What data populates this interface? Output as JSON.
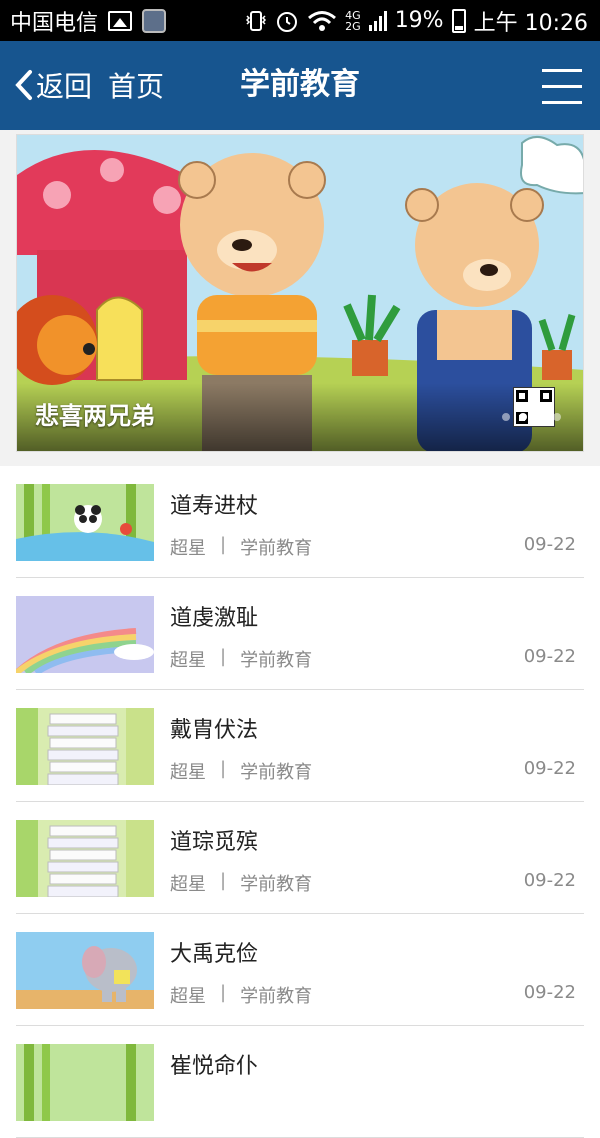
{
  "status_bar": {
    "carrier": "中国电信",
    "network_top": "4G",
    "network_bottom": "2G",
    "battery": "19%",
    "time": "上午 10:26"
  },
  "header": {
    "back_label": "返回",
    "home_label": "首页",
    "title": "学前教育",
    "bg_color": "#17558f"
  },
  "banner": {
    "caption": "悲喜两兄弟",
    "dots": 4,
    "active_dot": 2
  },
  "list": {
    "items": [
      {
        "title": "道寿进杖",
        "author": "超星",
        "category": "学前教育",
        "date": "09-22",
        "thumb": "panda-bamboo"
      },
      {
        "title": "道虔激耻",
        "author": "超星",
        "category": "学前教育",
        "date": "09-22",
        "thumb": "rainbow"
      },
      {
        "title": "戴胄伏法",
        "author": "超星",
        "category": "学前教育",
        "date": "09-22",
        "thumb": "books-stack"
      },
      {
        "title": "道琮觅殡",
        "author": "超星",
        "category": "学前教育",
        "date": "09-22",
        "thumb": "books-stack"
      },
      {
        "title": "大禹克俭",
        "author": "超星",
        "category": "学前教育",
        "date": "09-22",
        "thumb": "elephant"
      },
      {
        "title": "崔悦命仆",
        "author": "",
        "category": "",
        "date": "",
        "thumb": "panda-bamboo"
      }
    ]
  }
}
